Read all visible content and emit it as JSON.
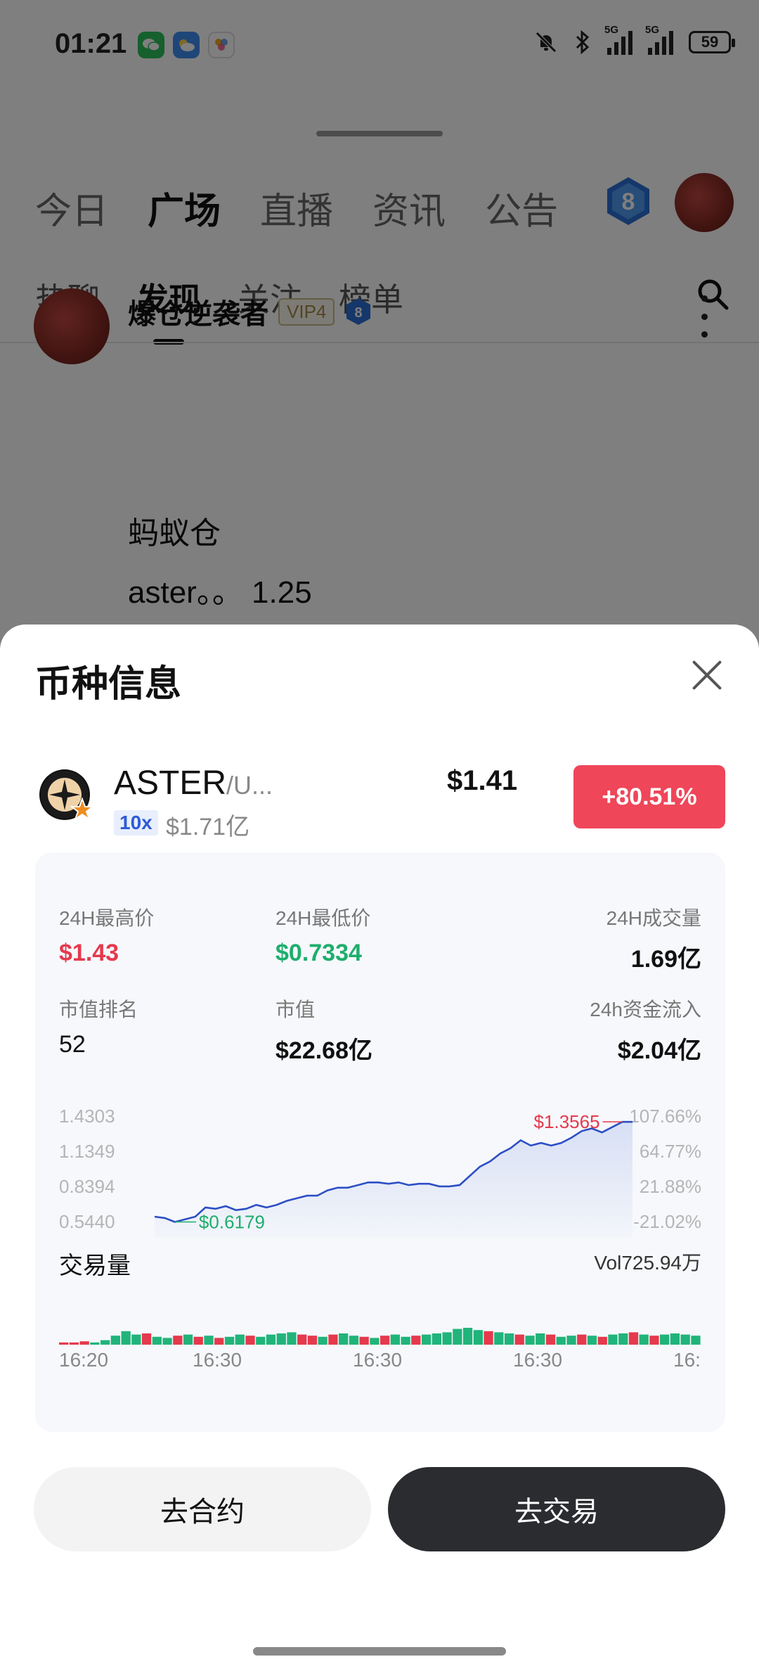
{
  "status_bar": {
    "time": "01:21",
    "battery": "59",
    "net_label_1": "5G",
    "net_label_2": "5G"
  },
  "background": {
    "main_tabs": [
      {
        "label": "今日",
        "active": false
      },
      {
        "label": "广场",
        "active": true
      },
      {
        "label": "直播",
        "active": false
      },
      {
        "label": "资讯",
        "active": false
      },
      {
        "label": "公告",
        "active": false
      }
    ],
    "level": "8",
    "sub_tabs": [
      {
        "label": "热聊",
        "active": false
      },
      {
        "label": "发现",
        "active": true
      },
      {
        "label": "关注",
        "active": false
      },
      {
        "label": "榜单",
        "active": false
      }
    ],
    "post": {
      "author": "爆仓逆袭者",
      "vip": "VIP4",
      "level": "8",
      "line1": "蚂蚁仓",
      "line2": "aster。。 1.25"
    }
  },
  "sheet": {
    "title": "币种信息",
    "coin": {
      "name": "ASTER",
      "pair_suffix": "/U...",
      "leverage": "10x",
      "market_cap": "$1.71亿",
      "price": "$1.41",
      "change": "+80.51%"
    },
    "stats": {
      "high_label": "24H最高价",
      "high_value": "$1.43",
      "low_label": "24H最低价",
      "low_value": "$0.7334",
      "volume_label": "24H成交量",
      "volume_value": "1.69亿",
      "rank_label": "市值排名",
      "rank_value": "52",
      "mcap_label": "市值",
      "mcap_value": "$22.68亿",
      "inflow_label": "24h资金流入",
      "inflow_value": "$2.04亿"
    },
    "volume_section": {
      "label": "交易量",
      "total": "Vol725.94万"
    },
    "buttons": {
      "contract": "去合约",
      "trade": "去交易"
    }
  },
  "chart_data": [
    {
      "type": "line",
      "y_ticks_left": [
        "1.4303",
        "1.1349",
        "0.8394",
        "0.5440"
      ],
      "y_ticks_right": [
        "107.66%",
        "64.77%",
        "21.88%",
        "-21.02%"
      ],
      "ylim": [
        0.544,
        1.4303
      ],
      "min_annotation": "$0.6179",
      "max_annotation": "$1.3565",
      "values": [
        0.64,
        0.63,
        0.6,
        0.62,
        0.64,
        0.71,
        0.7,
        0.72,
        0.69,
        0.7,
        0.73,
        0.71,
        0.73,
        0.76,
        0.78,
        0.8,
        0.8,
        0.84,
        0.86,
        0.86,
        0.88,
        0.9,
        0.9,
        0.89,
        0.9,
        0.88,
        0.89,
        0.89,
        0.87,
        0.87,
        0.88,
        0.95,
        1.02,
        1.06,
        1.12,
        1.16,
        1.22,
        1.18,
        1.2,
        1.18,
        1.2,
        1.24,
        1.29,
        1.31,
        1.28,
        1.32,
        1.36,
        1.36
      ],
      "grid": false
    },
    {
      "type": "bar",
      "x_ticks": [
        "16:20",
        "16:30",
        "16:30",
        "16:30",
        "16:"
      ],
      "volumes": [
        2,
        2,
        3,
        2,
        4,
        8,
        12,
        9,
        10,
        7,
        6,
        8,
        9,
        7,
        8,
        6,
        7,
        9,
        8,
        7,
        9,
        10,
        11,
        9,
        8,
        7,
        9,
        10,
        8,
        7,
        6,
        8,
        9,
        7,
        8,
        9,
        10,
        11,
        14,
        15,
        13,
        12,
        11,
        10,
        9,
        8,
        10,
        9,
        7,
        8,
        9,
        8,
        7,
        9,
        10,
        11,
        9,
        8,
        9,
        10,
        9,
        8
      ],
      "colors": [
        "r",
        "r",
        "r",
        "g",
        "g",
        "g",
        "g",
        "g",
        "r",
        "g",
        "g",
        "r",
        "g",
        "r",
        "g",
        "r",
        "g",
        "g",
        "r",
        "g",
        "g",
        "g",
        "g",
        "r",
        "r",
        "g",
        "r",
        "g",
        "g",
        "r",
        "g",
        "r",
        "g",
        "g",
        "r",
        "g",
        "g",
        "g",
        "g",
        "g",
        "g",
        "r",
        "g",
        "g",
        "r",
        "g",
        "g",
        "r",
        "g",
        "g",
        "r",
        "g",
        "r",
        "g",
        "g",
        "r",
        "g",
        "r",
        "g",
        "g",
        "g",
        "g"
      ]
    }
  ]
}
